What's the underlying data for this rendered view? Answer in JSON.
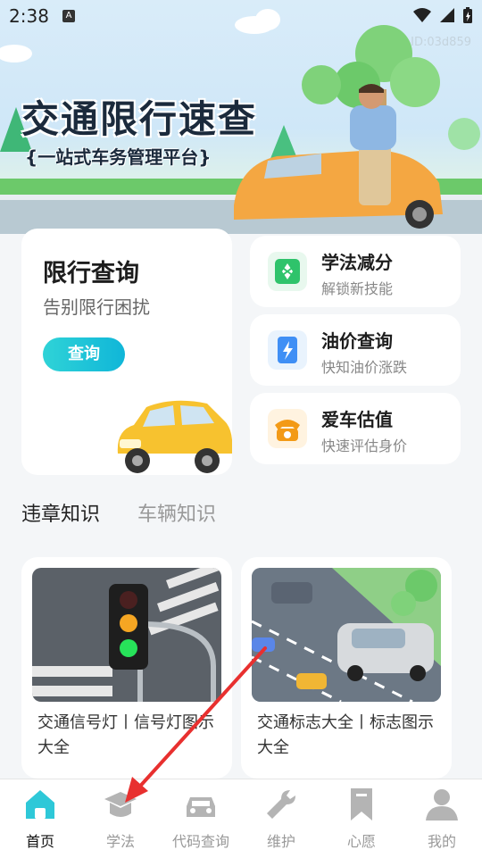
{
  "status": {
    "time": "2:38",
    "a_badge": "A"
  },
  "banner": {
    "id_text": "ID:03d859",
    "title": "交通限行速查",
    "subtitle": "{一站式车务管理平台}"
  },
  "main_card": {
    "title": "限行查询",
    "subtitle": "告别限行困扰",
    "button": "查询"
  },
  "side_cards": [
    {
      "title": "学法减分",
      "subtitle": "解锁新技能",
      "icon": "book-leaf-icon"
    },
    {
      "title": "油价查询",
      "subtitle": "快知油价涨跌",
      "icon": "fuel-pump-icon"
    },
    {
      "title": "爱车估值",
      "subtitle": "快速评估身价",
      "icon": "phone-icon"
    }
  ],
  "tabs": {
    "active": "违章知识",
    "inactive": "车辆知识"
  },
  "knowledge": [
    {
      "text": "交通信号灯丨信号灯图示大全"
    },
    {
      "text": "交通标志大全丨标志图示大全"
    }
  ],
  "nav": [
    {
      "label": "首页",
      "icon": "home-icon"
    },
    {
      "label": "学法",
      "icon": "graduation-cap-icon"
    },
    {
      "label": "代码查询",
      "icon": "car-icon"
    },
    {
      "label": "维护",
      "icon": "wrench-icon"
    },
    {
      "label": "心愿",
      "icon": "bookmark-icon"
    },
    {
      "label": "我的",
      "icon": "user-icon"
    }
  ],
  "colors": {
    "accent": "#15bfd6",
    "nav_active": "#2ec8d8",
    "nav_inactive": "#b4b4b4",
    "annotation": "#e8302f"
  }
}
